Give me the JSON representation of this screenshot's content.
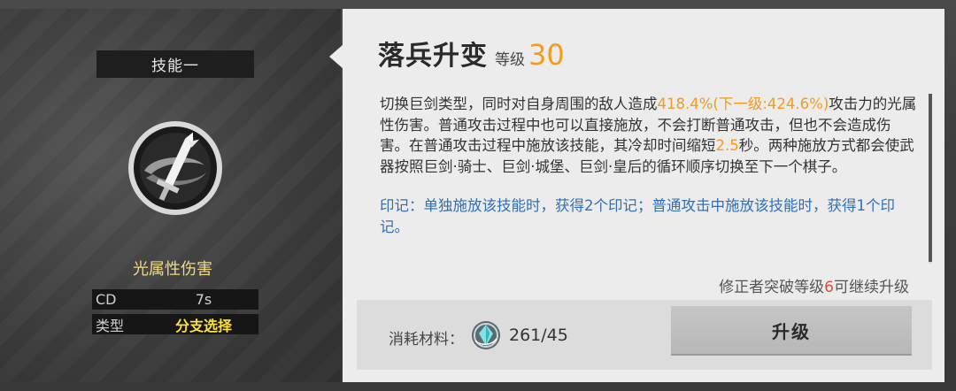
{
  "skill_panel": {
    "header": "技能一",
    "icon": "greatsword-skill-icon",
    "damage_type": "光属性伤害",
    "stats": [
      {
        "key": "CD",
        "value": "7s"
      },
      {
        "key": "类型",
        "value": "分支选择"
      }
    ]
  },
  "detail": {
    "name": "落兵升变",
    "level_label": "等级",
    "level": "30",
    "description": {
      "p1_a": "切换巨剑类型，同时对自身周围的敌人造成",
      "p1_hl1": "418.4%(下一级:424.6%)",
      "p1_b": "攻击力的光属性伤害。普通攻击过程中也可以直接施放，不会打断普通攻击，但也不会造成伤害。在普通攻击过程中施放该技能，其冷却时间缩短",
      "p1_hl2": "2.5",
      "p1_c": "秒。两种施放方式都会使武器按照巨剑·骑士、巨剑·城堡、巨剑·皇后的循环顺序切换至下一个棋子。",
      "p2": "印记：单独施放该技能时，获得2个印记；普通攻击中施放该技能时，获得1个印记。"
    },
    "upgrade_note_a": "修正者突破等级",
    "upgrade_note_num": "6",
    "upgrade_note_b": "可继续升级",
    "cost_label": "消耗材料：",
    "material_icon": "crystal-material-icon",
    "material_count": "261/45",
    "upgrade_button": "升级"
  },
  "colors": {
    "accent_orange": "#f59a1a",
    "mark_blue": "#2f6fb8",
    "type_yellow": "#ffe13a",
    "damage_gold": "#f0d98a",
    "warning_red": "#e04a3a"
  }
}
